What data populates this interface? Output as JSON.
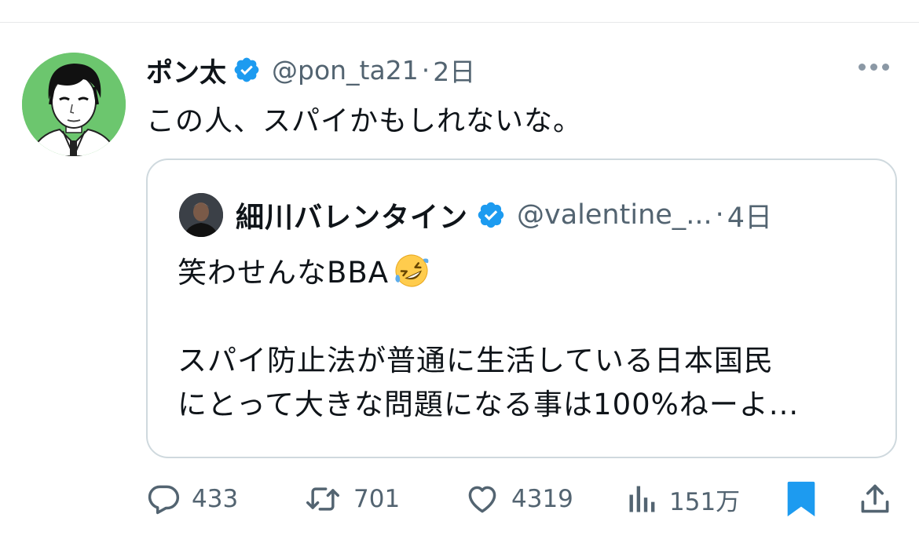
{
  "tweet": {
    "author": {
      "display_name": "ポン太",
      "handle": "@pon_ta21",
      "separator": "·",
      "time": "2日"
    },
    "text": "この人、スパイかもしれないな。",
    "quote": {
      "author": {
        "display_name": "細川バレンタイン",
        "handle": "@valentine_...",
        "separator": "·",
        "time": "4日"
      },
      "lines": [
        "笑わせんなBBA",
        "スパイ防止法が普通に生活している日本国民",
        "にとって大きな問題になる事は100%ねーよ..."
      ],
      "emoji": "rolling-on-floor-laughing"
    },
    "actions": {
      "reply_count": "433",
      "retweet_count": "701",
      "like_count": "4319",
      "views_count": "151万"
    }
  },
  "colors": {
    "verified": "#1d9bf0",
    "text_primary": "#0f1419",
    "text_secondary": "#536471",
    "bookmark_active": "#1d9bf0",
    "border": "#cfd9de"
  },
  "icons": [
    "verified-badge-icon",
    "more-options-icon",
    "reply-icon",
    "retweet-icon",
    "like-icon",
    "views-icon",
    "bookmark-icon",
    "share-icon"
  ]
}
